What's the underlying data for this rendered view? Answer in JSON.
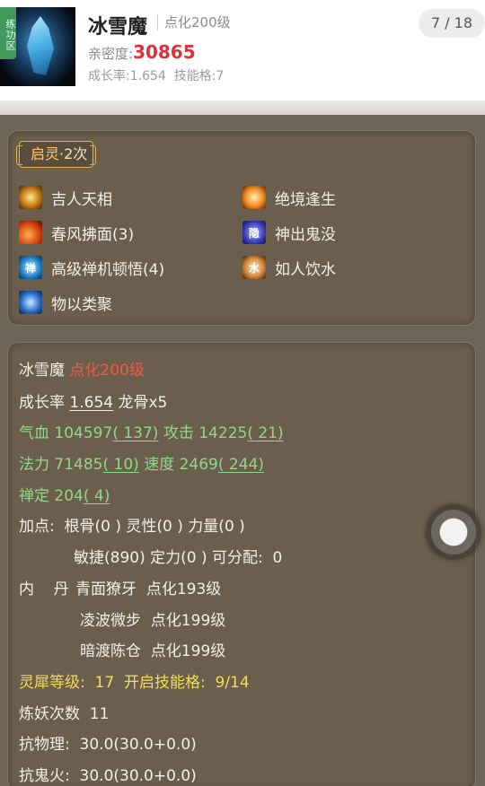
{
  "header": {
    "zone_tag": "练功区",
    "pet_name": "冰雪魔",
    "level_tag": "点化200级",
    "intimacy_label": "亲密度:",
    "intimacy_value": "30865",
    "growth_line": "成长率:1.654  技能格:7",
    "page_indicator": "7 / 18"
  },
  "skills_panel": {
    "badge_main": "启灵",
    "badge_count": "·2次",
    "skills": [
      {
        "name": "吉人天相",
        "icon": "jiren-icon"
      },
      {
        "name": "绝境逢生",
        "icon": "juejing-icon"
      },
      {
        "name": "春风拂面(3)",
        "icon": "chunfeng-icon"
      },
      {
        "name": "神出鬼没",
        "icon": "shenchu-icon",
        "glyph": "隐"
      },
      {
        "name": "高级禅机顿悟(4)",
        "icon": "chanji-icon",
        "glyph": "禅"
      },
      {
        "name": "如人饮水",
        "icon": "ruren-icon",
        "glyph": "水"
      },
      {
        "name": "物以类聚",
        "icon": "wuyi-icon"
      }
    ]
  },
  "stats_panel": {
    "name": "冰雪魔",
    "level": "点化200级",
    "growth_label": "成长率 ",
    "growth_value": "1.654",
    "dragon_bone": " 龙骨x5",
    "hp": {
      "label": "气血 104597",
      "bonus": "( 137)",
      "atk_label": " 攻击 14225",
      "atk_bonus": "( 21)"
    },
    "mp": {
      "label": "法力 71485",
      "bonus": "( 10)",
      "spd_label": " 速度 2469",
      "spd_bonus": "( 244)"
    },
    "chanding": {
      "label": "禅定 204",
      "bonus": "( 4)"
    },
    "points_line1": "加点:  根骨(0 ) 灵性(0 ) 力量(0 )",
    "points_line2": "敏捷(890) 定力(0 ) 可分配:  0",
    "neidan_label": "内    丹",
    "neidan": [
      "青面獠牙  点化193级",
      "凌波微步  点化199级",
      "暗渡陈仓  点化199级"
    ],
    "lingxi": "灵犀等级:  17  开启技能格:  9/14",
    "lianyao": "炼妖次数  11",
    "resist_physical": "抗物理:  30.0(30.0+0.0)",
    "resist_ghostfire": "抗鬼火:  30.0(30.0+0.0)"
  }
}
